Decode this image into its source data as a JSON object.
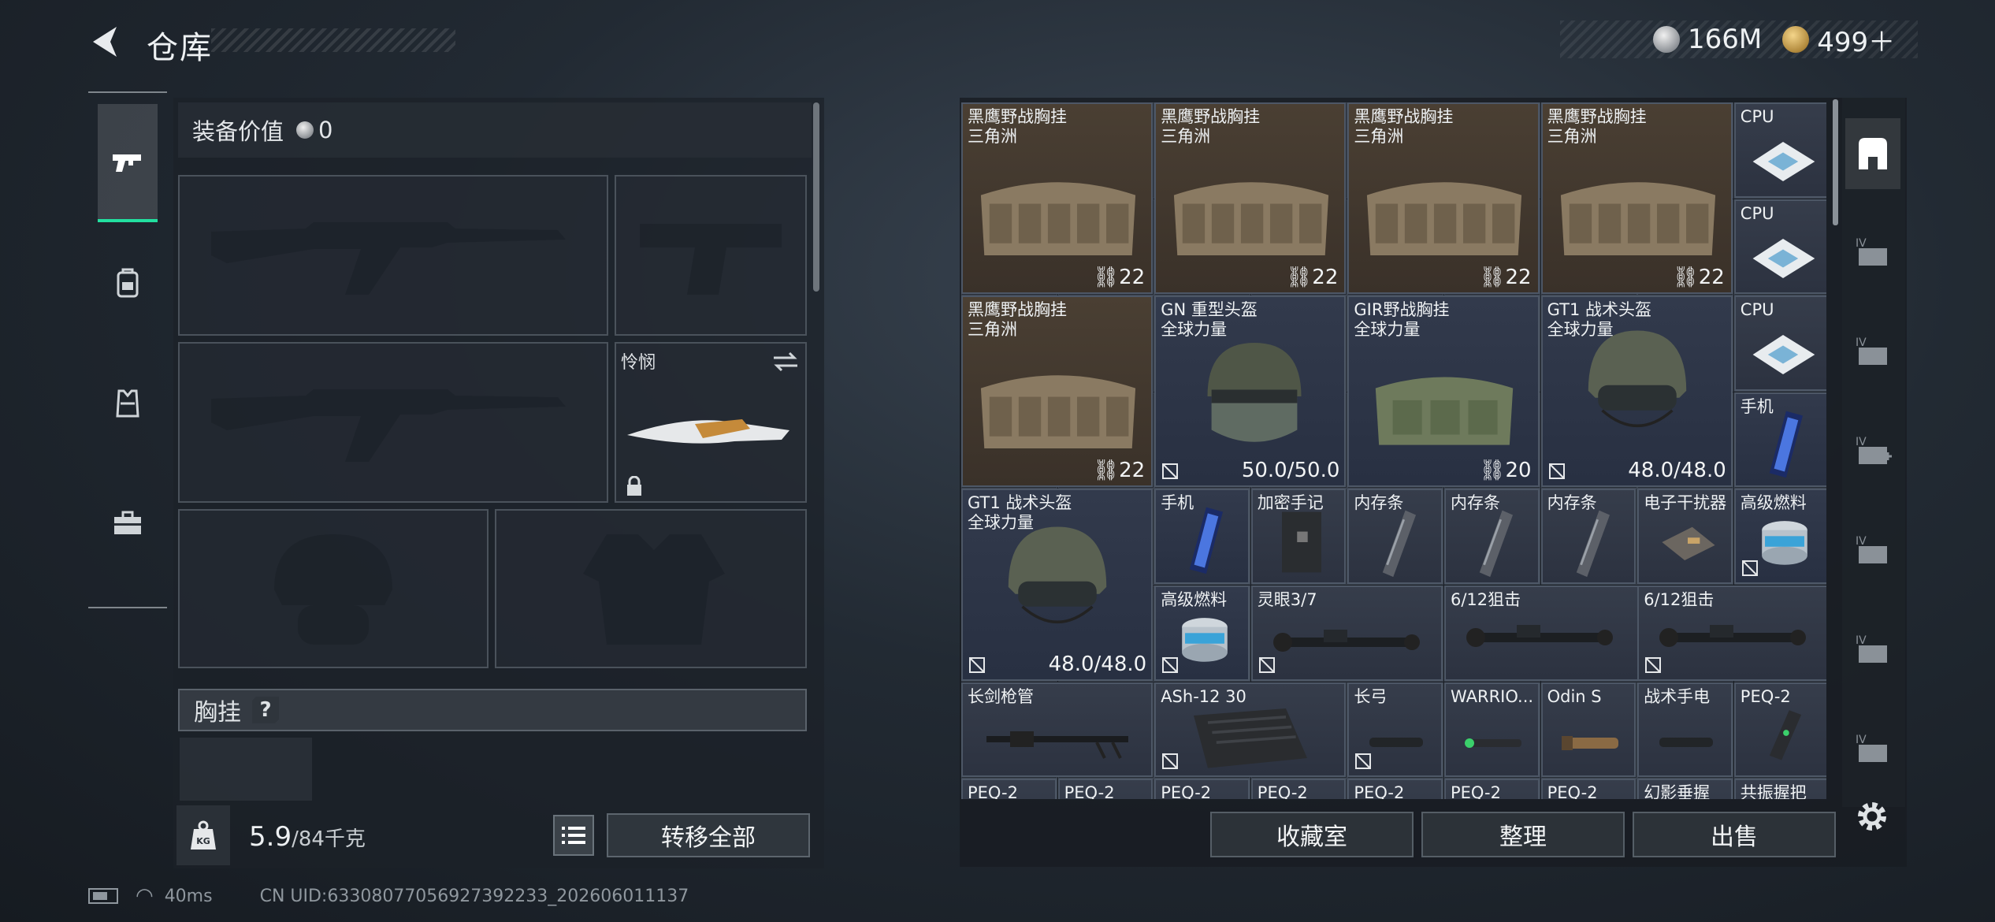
{
  "header": {
    "title": "仓库",
    "back_icon": "back-arrow-icon"
  },
  "currency": {
    "silver": "166M",
    "gold": "499＋"
  },
  "tabs": [
    {
      "name": "weapons",
      "icon": "pistol-icon",
      "active": true
    },
    {
      "name": "backpack",
      "icon": "backpack-icon",
      "active": false
    },
    {
      "name": "armor",
      "icon": "vest-icon",
      "active": false
    },
    {
      "name": "toolbox",
      "icon": "toolbox-icon",
      "active": false
    }
  ],
  "equipment": {
    "value_label": "装备价值",
    "value": "0",
    "knife_label": "怜悯",
    "chest_label": "胸挂",
    "chest_help": "?"
  },
  "weight": {
    "current": "5.9",
    "max": "/84千克"
  },
  "buttons": {
    "transfer_all": "转移全部",
    "collection": "收藏室",
    "sort": "整理",
    "sell": "出售"
  },
  "status": {
    "ping": "40ms",
    "uid": "CN UID:6330807705692739223​3_202606011137"
  },
  "stash": {
    "big_items": [
      {
        "name": "黑鹰野战胸挂\n三角洲",
        "count": "22",
        "color": "brown",
        "kind": "rig"
      },
      {
        "name": "黑鹰野战胸挂\n三角洲",
        "count": "22",
        "color": "brown",
        "kind": "rig"
      },
      {
        "name": "黑鹰野战胸挂\n三角洲",
        "count": "22",
        "color": "brown",
        "kind": "rig"
      },
      {
        "name": "黑鹰野战胸挂\n三角洲",
        "count": "22",
        "color": "brown",
        "kind": "rig"
      },
      {
        "name": "黑鹰野战胸挂\n三角洲",
        "count": "22",
        "color": "brown",
        "kind": "rig"
      },
      {
        "name": "GN 重型头盔\n全球力量",
        "durability": "50.0/50.0",
        "color": "blue",
        "kind": "helmet-heavy"
      },
      {
        "name": "GIR野战胸挂\n全球力量",
        "count": "20",
        "color": "blue",
        "kind": "rig-green"
      },
      {
        "name": "GT1 战术头盔\n全球力量",
        "durability": "48.0/48.0",
        "color": "blue",
        "kind": "helmet"
      },
      {
        "name": "GT1 战术头盔\n全球力量",
        "durability": "48.0/48.0",
        "color": "blue",
        "kind": "helmet"
      }
    ],
    "small_items": {
      "cpu": "CPU",
      "phone": "手机",
      "notebook": "加密手记",
      "ram": "内存条",
      "jammer": "电子干扰器",
      "fuel": "高级燃料",
      "scope_ling": "灵眼3/7",
      "scope_612": "6/12狙击",
      "barrel": "长剑枪管",
      "mag": "ASh-12 30",
      "longbow": "长弓",
      "warrior": "WARRIO...",
      "odin": "Odin S",
      "flashlight": "战术手电",
      "peq": "PEQ-2",
      "grip_phantom": "幻影垂握",
      "grip_resonance": "共振握把"
    }
  }
}
